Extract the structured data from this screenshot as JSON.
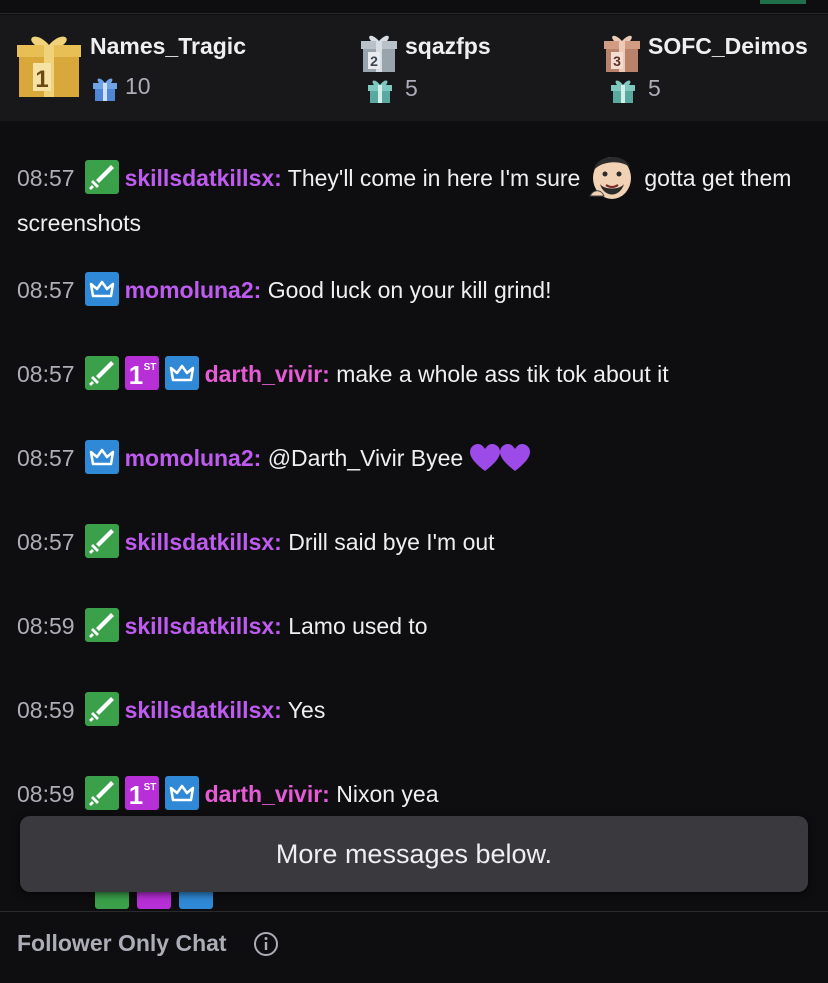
{
  "leaderboard": [
    {
      "rank": "1",
      "name": "Names_Tragic",
      "count": "10",
      "icon": "gold-gift-icon",
      "color": "#d8a93a"
    },
    {
      "rank": "2",
      "name": "sqazfps",
      "count": "5",
      "icon": "silver-gift-icon",
      "color": "#a9b3bc"
    },
    {
      "rank": "3",
      "name": "SOFC_Deimos",
      "count": "5",
      "icon": "bronze-gift-icon",
      "color": "#c9937a"
    }
  ],
  "messages": [
    {
      "time": "08:57",
      "badges": [
        "sword"
      ],
      "user": "skillsdatkillsx:",
      "text1": "They'll come in here I'm sure",
      "emote": "face-emote",
      "text2": "gotta get them screenshots"
    },
    {
      "time": "08:57",
      "badges": [
        "crown"
      ],
      "user": "momoluna2:",
      "text1": "Good luck on your kill grind!"
    },
    {
      "time": "08:57",
      "badges": [
        "sword",
        "first",
        "crown"
      ],
      "user": "darth_vivir:",
      "text1": "make a whole ass tik tok about it"
    },
    {
      "time": "08:57",
      "badges": [
        "crown"
      ],
      "user": "momoluna2:",
      "text1": "@Darth_Vivir Byee"
    },
    {
      "time": "08:57",
      "badges": [
        "sword"
      ],
      "user": "skillsdatkillsx:",
      "text1": "Drill said bye I'm out"
    },
    {
      "time": "08:59",
      "badges": [
        "sword"
      ],
      "user": "skillsdatkillsx:",
      "text1": "Lamo used to"
    },
    {
      "time": "08:59",
      "badges": [
        "sword"
      ],
      "user": "skillsdatkillsx:",
      "text1": "Yes"
    },
    {
      "time": "08:59",
      "badges": [
        "sword",
        "first",
        "crown"
      ],
      "user": "darth_vivir:",
      "text1": "Nixon yea"
    }
  ],
  "more_messages_label": "More messages below.",
  "footer": {
    "label": "Follower Only Chat"
  },
  "colors": {
    "username_purple": "#bf5bf0",
    "username_pink": "#e75bd6",
    "sword_badge": "#3aa14a",
    "crown_badge": "#2f89d6",
    "first_badge": "#b72fd6"
  }
}
